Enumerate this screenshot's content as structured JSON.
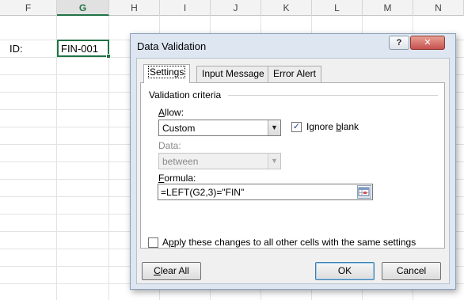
{
  "spreadsheet": {
    "columns": [
      "F",
      "G",
      "H",
      "I",
      "J",
      "K",
      "L",
      "M",
      "N"
    ],
    "selected_column": "G",
    "cells": {
      "f_row2": "ID:",
      "g_row2": "FIN-001"
    }
  },
  "dialog": {
    "title": "Data Validation",
    "help_label": "?",
    "close_label": "✕",
    "tabs": [
      "Settings",
      "Input Message",
      "Error Alert"
    ],
    "active_tab": "Settings",
    "settings": {
      "group_title": "Validation criteria",
      "allow_label_u": "A",
      "allow_label_rest": "llow:",
      "allow_value": "Custom",
      "ignore_blank_before": "Ignore ",
      "ignore_blank_u": "b",
      "ignore_blank_after": "lank",
      "ignore_blank_checked": true,
      "data_label": "Data:",
      "data_value": "between",
      "formula_label_u": "F",
      "formula_label_rest": "ormula:",
      "formula_value": "=LEFT(G2,3)=\"FIN\""
    },
    "apply_all_before": "A",
    "apply_all_u": "p",
    "apply_all_after": "ply these changes to all other cells with the same settings",
    "apply_all_checked": false,
    "buttons": {
      "clear_all_u": "C",
      "clear_all_rest": "lear All",
      "ok": "OK",
      "cancel": "Cancel"
    },
    "icons": {
      "dropdown": "chevron-down-icon",
      "checkmark": "checkmark-icon",
      "range_selector": "range-selector-icon"
    }
  }
}
